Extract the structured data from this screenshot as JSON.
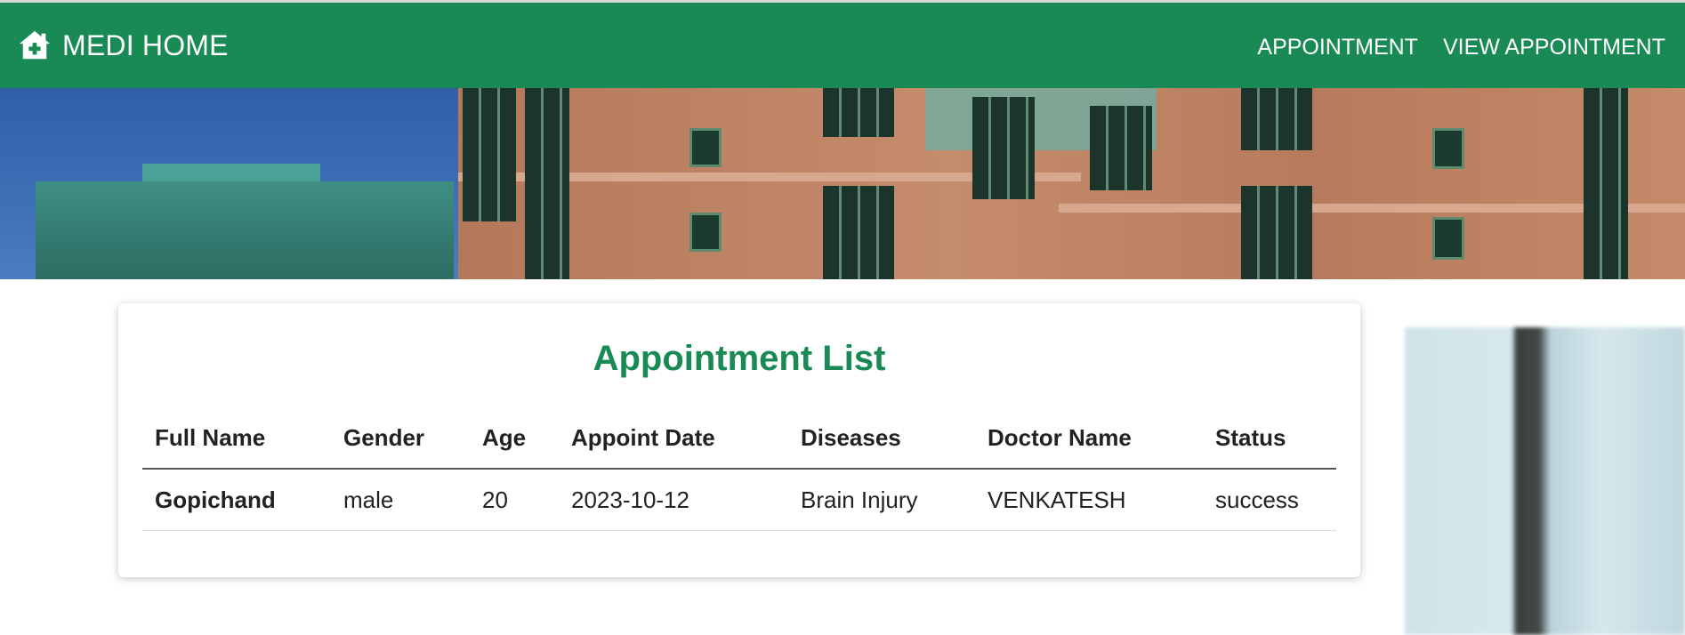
{
  "navbar": {
    "brand": "MEDI HOME",
    "brand_icon": "house-medical-icon",
    "links": [
      "APPOINTMENT",
      "VIEW APPOINTMENT"
    ],
    "color": "#1a8a55"
  },
  "card": {
    "title": "Appointment List",
    "columns": [
      "Full Name",
      "Gender",
      "Age",
      "Appoint Date",
      "Diseases",
      "Doctor Name",
      "Status"
    ],
    "rows": [
      [
        "Gopichand",
        "male",
        "20",
        "2023-10-12",
        "Brain Injury",
        "VENKATESH",
        "success"
      ]
    ]
  }
}
